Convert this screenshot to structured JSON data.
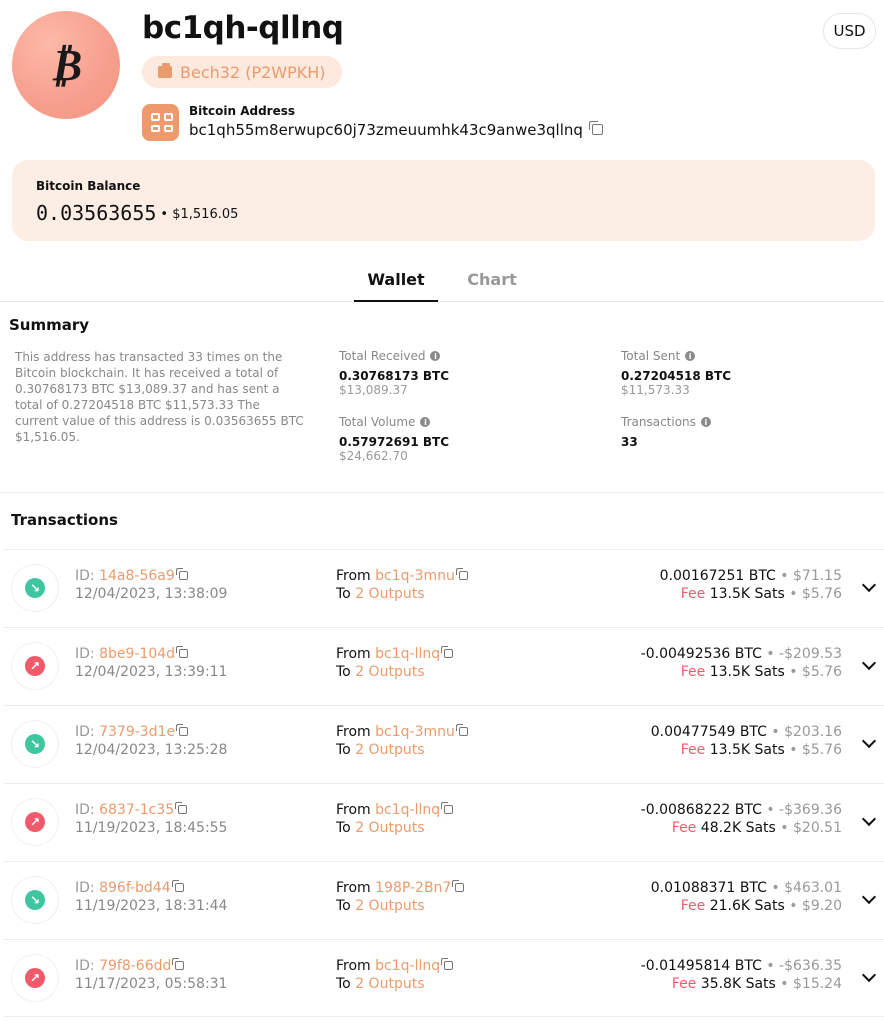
{
  "header": {
    "title": "bc1qh-qllnq",
    "avatar_glyph": "₿",
    "badge": "Bech32 (P2WPKH)",
    "address_label": "Bitcoin Address",
    "address": "bc1qh55m8erwupc60j73zmeuumhk43c9anwe3qllnq",
    "currency": "USD"
  },
  "balance": {
    "label": "Bitcoin Balance",
    "btc": "0.03563655",
    "usd": "• $1,516.05"
  },
  "tabs": {
    "wallet": "Wallet",
    "chart": "Chart"
  },
  "summary": {
    "title": "Summary",
    "text": "This address has transacted 33 times on the Bitcoin blockchain. It has received a total of 0.30768173 BTC $13,089.37 and has sent a total of 0.27204518 BTC $11,573.33 The current value of this address is 0.03563655 BTC $1,516.05.",
    "total_received": {
      "label": "Total Received",
      "btc": "0.30768173 BTC",
      "usd": "$13,089.37"
    },
    "total_sent": {
      "label": "Total Sent",
      "btc": "0.27204518 BTC",
      "usd": "$11,573.33"
    },
    "total_volume": {
      "label": "Total Volume",
      "btc": "0.57972691 BTC",
      "usd": "$24,662.70"
    },
    "transactions": {
      "label": "Transactions",
      "value": "33"
    }
  },
  "transactions": {
    "title": "Transactions",
    "id_prefix": "ID:",
    "from_prefix": "From",
    "to_prefix": "To",
    "fee_prefix": "Fee",
    "colors": {
      "incoming": "#3ec6a0",
      "outgoing": "#f05a6a",
      "link": "#ea9b6c"
    },
    "rows": [
      {
        "direction": "in",
        "id": "14a8-56a9",
        "date": "12/04/2023, 13:38:09",
        "from": "bc1q-3mnu",
        "to": "2 Outputs",
        "amount": "0.00167251 BTC",
        "amount_usd": "• $71.15",
        "fee": "13.5K Sats",
        "fee_usd": "• $5.76"
      },
      {
        "direction": "out",
        "id": "8be9-104d",
        "date": "12/04/2023, 13:39:11",
        "from": "bc1q-llnq",
        "to": "2 Outputs",
        "amount": "-0.00492536 BTC",
        "amount_usd": "• -$209.53",
        "fee": "13.5K Sats",
        "fee_usd": "• $5.76"
      },
      {
        "direction": "in",
        "id": "7379-3d1e",
        "date": "12/04/2023, 13:25:28",
        "from": "bc1q-3mnu",
        "to": "2 Outputs",
        "amount": "0.00477549 BTC",
        "amount_usd": "• $203.16",
        "fee": "13.5K Sats",
        "fee_usd": "• $5.76"
      },
      {
        "direction": "out",
        "id": "6837-1c35",
        "date": "11/19/2023, 18:45:55",
        "from": "bc1q-llnq",
        "to": "2 Outputs",
        "amount": "-0.00868222 BTC",
        "amount_usd": "• -$369.36",
        "fee": "48.2K Sats",
        "fee_usd": "• $20.51"
      },
      {
        "direction": "in",
        "id": "896f-bd44",
        "date": "11/19/2023, 18:31:44",
        "from": "198P-2Bn7",
        "to": "2 Outputs",
        "amount": "0.01088371 BTC",
        "amount_usd": "• $463.01",
        "fee": "21.6K Sats",
        "fee_usd": "• $9.20"
      },
      {
        "direction": "out",
        "id": "79f8-66dd",
        "date": "11/17/2023, 05:58:31",
        "from": "bc1q-llnq",
        "to": "2 Outputs",
        "amount": "-0.01495814 BTC",
        "amount_usd": "• -$636.35",
        "fee": "35.8K Sats",
        "fee_usd": "• $15.24"
      }
    ]
  }
}
